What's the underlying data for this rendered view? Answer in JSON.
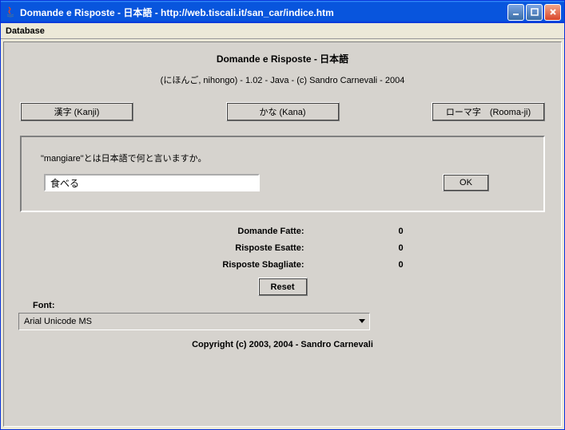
{
  "titlebar": {
    "title": "Domande e Risposte  -  日本語  -   http://web.tiscali.it/san_car/indice.htm"
  },
  "menubar": {
    "database": "Database"
  },
  "main": {
    "heading": "Domande e Risposte - 日本語",
    "subheading": "(にほんご, nihongo) - 1.02 - Java - (c) Sandro Carnevali - 2004",
    "modes": {
      "kanji": "漢字 (Kanji)",
      "kana": "かな (Kana)",
      "roomaji": "ローマ字　(Rooma-ji)"
    },
    "qa": {
      "question": "\"mangiare\"とは日本語で何と言いますか。",
      "answer_value": "食べる",
      "ok_label": "OK"
    },
    "stats": {
      "domande_fatte_label": "Domande Fatte:",
      "domande_fatte_value": "0",
      "risposte_esatte_label": "Risposte Esatte:",
      "risposte_esatte_value": "0",
      "risposte_sbagliate_label": "Risposte Sbagliate:",
      "risposte_sbagliate_value": "0"
    },
    "reset_label": "Reset",
    "font": {
      "label": "Font:",
      "selected": "Arial Unicode MS"
    },
    "copyright": "Copyright (c) 2003, 2004 - Sandro Carnevali"
  }
}
